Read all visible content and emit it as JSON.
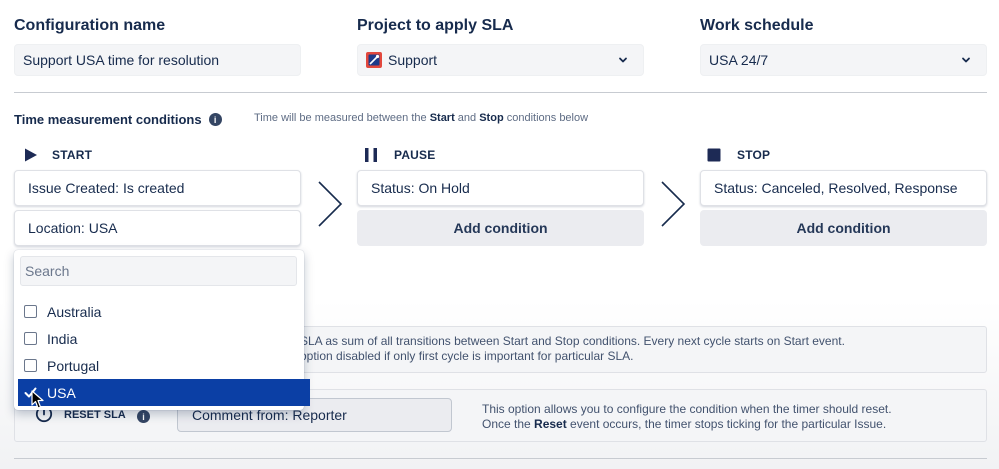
{
  "config": {
    "name_label": "Configuration name",
    "name_value": "Support USA time for resolution",
    "project_label": "Project to apply SLA",
    "project_value": "Support",
    "schedule_label": "Work schedule",
    "schedule_value": "USA 24/7"
  },
  "time": {
    "title": "Time measurement conditions",
    "hint_pre": "Time will be measured between the ",
    "hint_start": "Start",
    "hint_mid": " and ",
    "hint_stop": "Stop",
    "hint_post": " conditions below"
  },
  "columns": {
    "start": {
      "label": "START",
      "conditions": [
        "Issue Created: Is created",
        "Location: USA"
      ]
    },
    "pause": {
      "label": "PAUSE",
      "conditions": [
        "Status: On Hold"
      ],
      "add_label": "Add condition"
    },
    "stop": {
      "label": "STOP",
      "conditions": [
        "Status: Canceled, Resolved, Response"
      ],
      "add_label": "Add condition"
    }
  },
  "cycle": {
    "line1": "SLA as sum of all transitions between Start and Stop conditions. Every next cycle starts on Start event.",
    "line2": "option disabled if only first cycle is important for particular SLA."
  },
  "reset": {
    "label": "RESET SLA",
    "value": "Comment from: Reporter",
    "desc1": "This option allows you to configure the condition when the timer should reset.",
    "desc2_pre": "Once the ",
    "desc2_bold": "Reset",
    "desc2_post": " event occurs, the timer stops ticking for the particular Issue."
  },
  "dropdown": {
    "search_placeholder": "Search",
    "options": [
      "Australia",
      "India",
      "Portugal",
      "USA"
    ],
    "selected": "USA"
  }
}
